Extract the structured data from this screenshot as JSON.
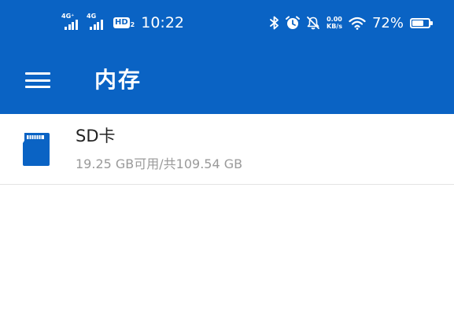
{
  "status_bar": {
    "signal1_type": "4G⁺",
    "signal2_type": "4G",
    "hd_label": "HD",
    "hd_sub": "2",
    "time": "10:22",
    "net_speed_value": "0.00",
    "net_speed_unit": "KB/s",
    "battery_percent": "72%",
    "battery_level": 0.72,
    "icons": [
      "bluetooth-icon",
      "alarm-icon",
      "mute-icon",
      "wifi-icon",
      "battery-icon"
    ]
  },
  "app_bar": {
    "title": "内存",
    "menu_icon": "hamburger-menu-icon",
    "background": "#0a63c4"
  },
  "storage": {
    "items": [
      {
        "icon": "sd-card-icon",
        "title": "SD卡",
        "subtitle": "19.25 GB可用/共109.54 GB"
      }
    ]
  },
  "colors": {
    "primary": "#0a63c4",
    "title_text": "#222222",
    "secondary_text": "#9a9a9a",
    "divider": "#e4e4e4"
  }
}
